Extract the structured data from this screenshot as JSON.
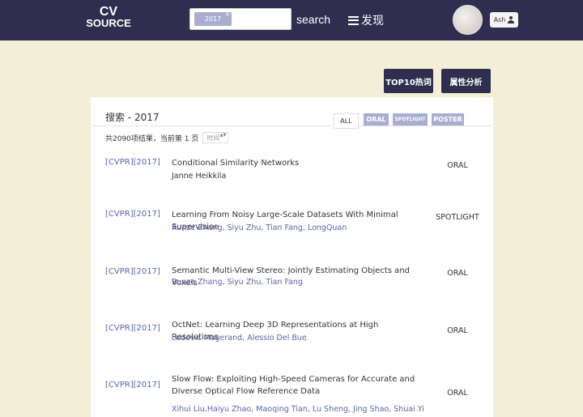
{
  "header": {
    "logo_line1": "CV",
    "logo_line2": "SOURCE",
    "search_tag": "2017",
    "search_tag_close": "×",
    "search_label": "search",
    "discover_label": "发现",
    "user_name": "Ash"
  },
  "actions": {
    "top10_label": "TOP10热词",
    "attr_label": "属性分析"
  },
  "results": {
    "title": "搜索 - 2017",
    "filters": [
      "ALL",
      "ORAL",
      "SPOTLIGHT",
      "POSTER"
    ],
    "summary": "共2090项结果，当前第 1 页",
    "sort_label": "时间",
    "sort_arrows": "▲▼",
    "rows": [
      {
        "venue": "[CVPR][2017]",
        "title": "Conditional Similarity Networks",
        "authors": "Janne Heikkila",
        "type": "ORAL"
      },
      {
        "venue": "[CVPR][2017]",
        "title": "Learning From Noisy Large-Scale Datasets With Minimal Supervision",
        "authors": "Runze Zhang, Siyu Zhu, Tian Fang, LongQuan",
        "type": "SPOTLIGHT"
      },
      {
        "venue": "[CVPR][2017]",
        "title": "Semantic Multi-View Stereo: Jointly Estimating Objects and Voxels",
        "authors": "Runze Zhang, Siyu Zhu, Tian Fang",
        "type": "ORAL"
      },
      {
        "venue": "[CVPR][2017]",
        "title": "OctNet: Learning Deep 3D Representations at High Resolutions",
        "authors": "Ludovic Magerand, Alessio Del Bue",
        "type": "ORAL"
      },
      {
        "venue": "[CVPR][2017]",
        "title": "Slow Flow: Exploiting High-Speed Cameras for Accurate and Diverse Optical Flow Reference Data",
        "authors": "Xihui Liu,Haiyu Zhao, Maoqing Tian, Lu Sheng, Jing Shao, Shuai Yi",
        "authors_more": "...",
        "type": "ORAL"
      }
    ]
  },
  "colors": {
    "navbar": "#2f2e4f",
    "background": "#f2efd6",
    "accent": "#a9aecf",
    "link": "#5a65a8"
  },
  "icons": [
    "menu-icon",
    "user-icon"
  ]
}
